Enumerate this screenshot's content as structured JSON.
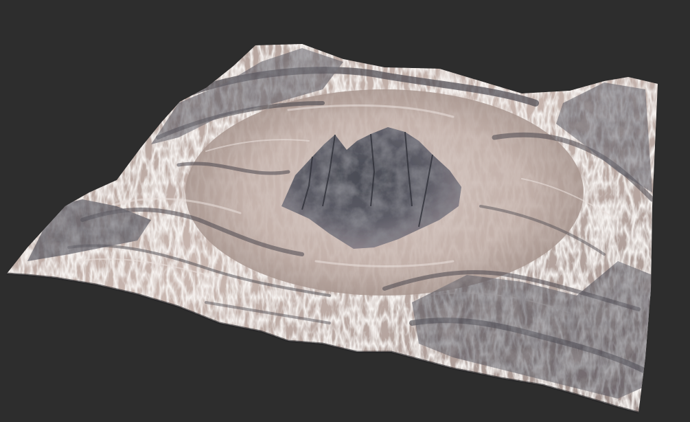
{
  "scene": {
    "background_color": "#2d2d2d",
    "subject": "terrain-heightmap-render",
    "palette": {
      "sand_light": "#d9c8c0",
      "sand_mid": "#b6a19a",
      "rock_dark": "#3b3e46",
      "rock_mid": "#6d6c74",
      "highlight": "#eae2de",
      "crater_floor": "#cbbab3"
    }
  }
}
